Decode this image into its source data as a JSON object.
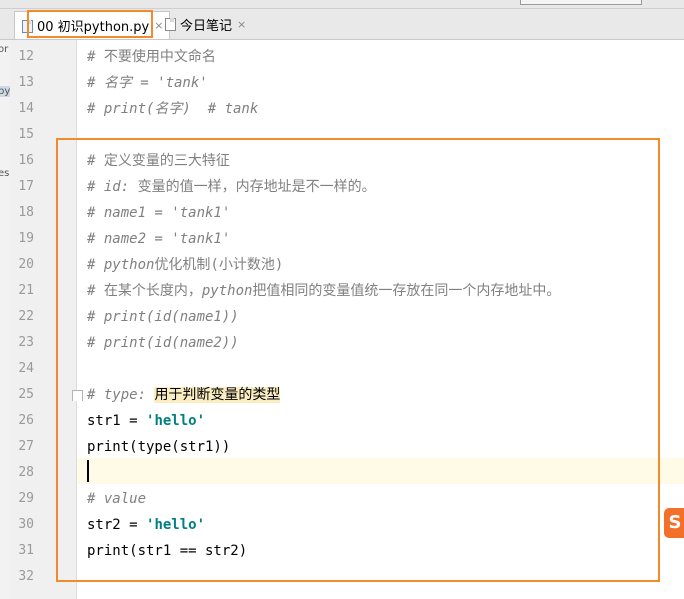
{
  "tabs": [
    {
      "label": "00 初识python.py",
      "close": "×",
      "icon": "python-file-icon"
    },
    {
      "label": "今日笔记",
      "close": "×",
      "icon": "text-file-icon"
    }
  ],
  "left_fragments": [
    "or",
    "py",
    "es"
  ],
  "colors": {
    "highlight_box": "#f28a2e",
    "comment": "#808080",
    "string": "#008080",
    "current_line": "#fffbe6"
  },
  "code": [
    {
      "n": "12",
      "segs": [
        {
          "t": "# 不要使用中文命名",
          "c": "cmt-zh"
        }
      ]
    },
    {
      "n": "13",
      "segs": [
        {
          "t": "# 名字 = 'tank'",
          "c": "cmt"
        }
      ]
    },
    {
      "n": "14",
      "segs": [
        {
          "t": "# print(名字)  # tank",
          "c": "cmt"
        }
      ]
    },
    {
      "n": "15",
      "segs": []
    },
    {
      "n": "16",
      "segs": [
        {
          "t": "# 定义变量的三大特征",
          "c": "cmt-zh"
        }
      ]
    },
    {
      "n": "17",
      "segs": [
        {
          "t": "# id: ",
          "c": "cmt"
        },
        {
          "t": "变量的值一样，内存地址是不一样的。",
          "c": "cmt-zh"
        }
      ]
    },
    {
      "n": "18",
      "segs": [
        {
          "t": "# name1 = 'tank1'",
          "c": "cmt"
        }
      ]
    },
    {
      "n": "19",
      "segs": [
        {
          "t": "# name2 = 'tank1'",
          "c": "cmt"
        }
      ]
    },
    {
      "n": "20",
      "segs": [
        {
          "t": "# python",
          "c": "cmt"
        },
        {
          "t": "优化机制(小计数池)",
          "c": "cmt-zh"
        }
      ]
    },
    {
      "n": "21",
      "segs": [
        {
          "t": "# 在某个长度内，",
          "c": "cmt-zh"
        },
        {
          "t": "python",
          "c": "cmt"
        },
        {
          "t": "把值相同的变量值统一存放在同一个内存地址中。",
          "c": "cmt-zh"
        }
      ]
    },
    {
      "n": "22",
      "segs": [
        {
          "t": "# print(id(name1))",
          "c": "cmt"
        }
      ]
    },
    {
      "n": "23",
      "segs": [
        {
          "t": "# print(id(name2))",
          "c": "cmt"
        }
      ]
    },
    {
      "n": "24",
      "segs": []
    },
    {
      "n": "25",
      "segs": [
        {
          "t": "# type: ",
          "c": "cmt"
        },
        {
          "t": "用于判断变量的类型",
          "c": "hl-word"
        }
      ]
    },
    {
      "n": "26",
      "segs": [
        {
          "t": "str1 = ",
          "c": ""
        },
        {
          "t": "'hello'",
          "c": "str"
        }
      ]
    },
    {
      "n": "27",
      "segs": [
        {
          "t": "print(type(str1))",
          "c": ""
        }
      ]
    },
    {
      "n": "28",
      "segs": []
    },
    {
      "n": "29",
      "segs": [
        {
          "t": "# value",
          "c": "cmt"
        }
      ]
    },
    {
      "n": "30",
      "segs": [
        {
          "t": "str2 = ",
          "c": ""
        },
        {
          "t": "'hello'",
          "c": "str"
        }
      ]
    },
    {
      "n": "31",
      "segs": [
        {
          "t": "print(str1 == str2)",
          "c": ""
        }
      ]
    },
    {
      "n": "32",
      "segs": []
    }
  ],
  "ime_badge": "S"
}
